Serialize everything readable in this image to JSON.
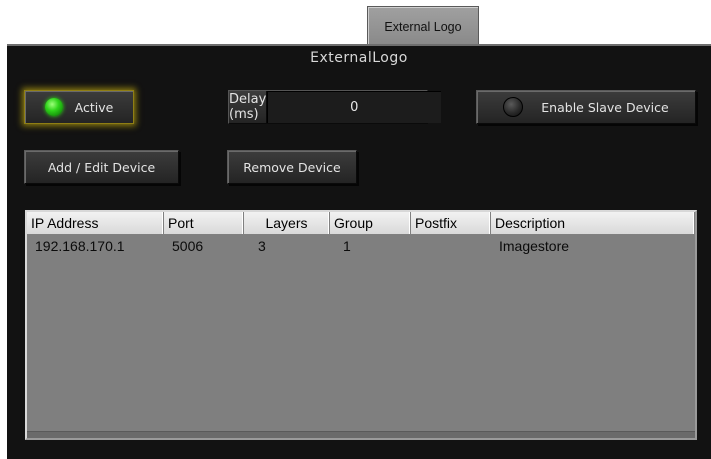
{
  "tab": {
    "label": "External Logo"
  },
  "panel": {
    "title": "ExternalLogo"
  },
  "controls": {
    "active_label": "Active",
    "active_led": "on",
    "delay_label": "Delay (ms)",
    "delay_value": "0",
    "slave_label": "Enable Slave Device",
    "slave_led": "off",
    "add_edit_label": "Add / Edit Device",
    "remove_label": "Remove Device"
  },
  "table": {
    "columns": [
      "IP Address",
      "Port",
      "Layers",
      "Group",
      "Postfix",
      "Description"
    ],
    "rows": [
      [
        "192.168.170.1",
        "5006",
        "3",
        "1",
        "",
        "Imagestore"
      ]
    ]
  },
  "colors": {
    "panel_bg": "#121212",
    "led_on": "#2fd41a",
    "active_glow": "#8a7a10",
    "table_bg": "#7f7f7f"
  }
}
